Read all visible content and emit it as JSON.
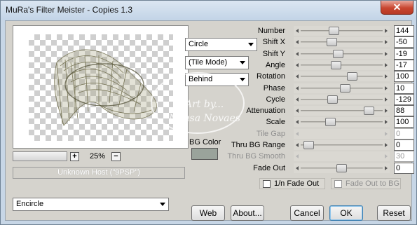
{
  "window": {
    "title": "MuRa's Filter Meister - Copies 1.3",
    "close_symbol": "✕"
  },
  "preview": {
    "zoom_minus": "−",
    "zoom_plus": "+",
    "zoom_value": "25%",
    "host_text": "Unknown Host (\"9PSP\")"
  },
  "combos": {
    "shape": "Circle",
    "tile_mode": "(Tile Mode)",
    "layer_mode": "Behind",
    "effect": "Encircle"
  },
  "bg_color": {
    "label": "BG Color",
    "color": "#9aa39b"
  },
  "controls": [
    {
      "label": "Number",
      "value": "144",
      "enabled": true,
      "position": 0.38
    },
    {
      "label": "Shift X",
      "value": "-50",
      "enabled": true,
      "position": 0.35
    },
    {
      "label": "Shift Y",
      "value": "-19",
      "enabled": true,
      "position": 0.45
    },
    {
      "label": "Angle",
      "value": "-17",
      "enabled": true,
      "position": 0.41
    },
    {
      "label": "Rotation",
      "value": "100",
      "enabled": true,
      "position": 0.66
    },
    {
      "label": "Phase",
      "value": "10",
      "enabled": true,
      "position": 0.55
    },
    {
      "label": "Cycle",
      "value": "-129",
      "enabled": true,
      "position": 0.36
    },
    {
      "label": "Attenuation",
      "value": "88",
      "enabled": true,
      "position": 0.91
    },
    {
      "label": "Scale",
      "value": "100",
      "enabled": true,
      "position": 0.33
    },
    {
      "label": "Tile Gap",
      "value": "0",
      "enabled": false,
      "position": null
    },
    {
      "label": "Thru BG Range",
      "value": "0",
      "enabled": true,
      "position": 0.0
    },
    {
      "label": "Thru BG Smooth",
      "value": "30",
      "enabled": false,
      "position": null
    },
    {
      "label": "Fade Out",
      "value": "0",
      "enabled": true,
      "position": 0.5
    }
  ],
  "checkboxes": {
    "fade_out_1n": "1/n Fade Out",
    "fade_out_to_bg": "Fade Out to BG"
  },
  "buttons": {
    "web": "Web",
    "about": "About...",
    "cancel": "Cancel",
    "ok": "OK",
    "reset": "Reset"
  },
  "watermark": {
    "line1": "Art by...",
    "line2": "Neusa Novaes"
  }
}
